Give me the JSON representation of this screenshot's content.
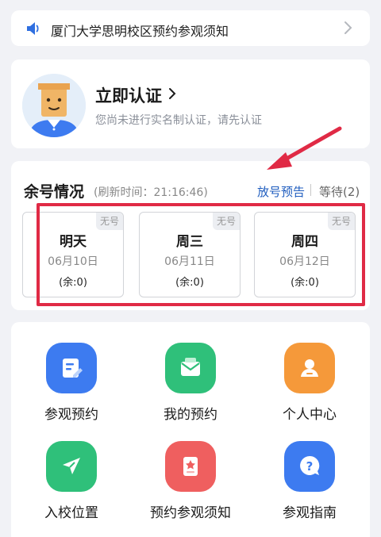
{
  "notice": {
    "text": "厦门大学思明校区预约参观须知",
    "icon": "speaker-icon"
  },
  "auth": {
    "title": "立即认证",
    "subtitle": "您尚未进行实名制认证，请先认证"
  },
  "quota": {
    "heading": "余号情况",
    "refresh": "(刷新时间：21:16:46)",
    "preview_link": "放号预告",
    "waitlist": "等待(2)",
    "days": [
      {
        "name": "明天",
        "date": "06月10日",
        "remaining": "(余:0)",
        "tag": "无号"
      },
      {
        "name": "周三",
        "date": "06月11日",
        "remaining": "(余:0)",
        "tag": "无号"
      },
      {
        "name": "周四",
        "date": "06月12日",
        "remaining": "(余:0)",
        "tag": "无号"
      }
    ]
  },
  "menu": {
    "items": [
      {
        "label": "参观预约",
        "icon": "edit-note-icon",
        "color": "#3d7bf0"
      },
      {
        "label": "我的预约",
        "icon": "envelope-icon",
        "color": "#2fc07a"
      },
      {
        "label": "个人中心",
        "icon": "person-icon",
        "color": "#f5993a"
      },
      {
        "label": "入校位置",
        "icon": "location-arrow-icon",
        "color": "#2fc07a"
      },
      {
        "label": "预约参观须知",
        "icon": "document-star-icon",
        "color": "#ef5f5f"
      },
      {
        "label": "参观指南",
        "icon": "help-chat-icon",
        "color": "#3d7bf0"
      }
    ]
  },
  "colors": {
    "background": "#f1f2f6",
    "link_blue": "#1f5dbf",
    "highlight_red": "#e02a45"
  }
}
